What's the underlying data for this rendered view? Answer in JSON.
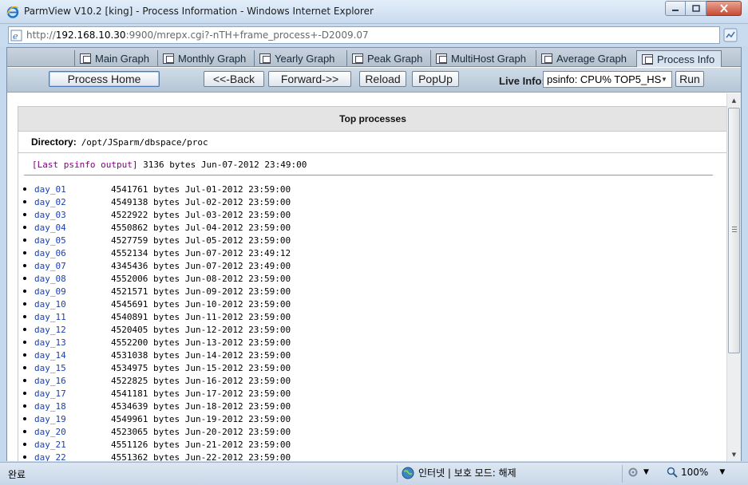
{
  "window": {
    "title": "ParmView V10.2 [king] - Process Information - Windows Internet Explorer"
  },
  "address": {
    "url_prefix": "http://",
    "url_host": "192.168.10.30",
    "url_rest": ":9900/mrepx.cgi?-nTH+frame_process+-D2009.07"
  },
  "tabs": [
    {
      "label": "Main Graph"
    },
    {
      "label": "Monthly Graph"
    },
    {
      "label": "Yearly Graph"
    },
    {
      "label": "Peak Graph"
    },
    {
      "label": "MultiHost Graph"
    },
    {
      "label": "Average Graph"
    },
    {
      "label": "Process Info"
    }
  ],
  "toolbar": {
    "process_home": "Process Home",
    "back": "<<-Back",
    "forward": "Forward->>",
    "reload": "Reload",
    "popup": "PopUp",
    "live_info_label": "Live Info:",
    "live_info_value": "psinfo: CPU% TOP5_HS",
    "run": "Run"
  },
  "panel": {
    "title": "Top processes",
    "directory_label": "Directory:",
    "directory_value": "/opt/JSparm/dbspace/proc",
    "last_link": "[Last psinfo output]",
    "last_info": "3136 bytes Jun-07-2012 23:49:00"
  },
  "files": [
    {
      "name": "day_01",
      "info": "4541761 bytes Jul-01-2012 23:59:00"
    },
    {
      "name": "day_02",
      "info": "4549138 bytes Jul-02-2012 23:59:00"
    },
    {
      "name": "day_03",
      "info": "4522922 bytes Jul-03-2012 23:59:00"
    },
    {
      "name": "day_04",
      "info": "4550862 bytes Jul-04-2012 23:59:00"
    },
    {
      "name": "day_05",
      "info": "4527759 bytes Jul-05-2012 23:59:00"
    },
    {
      "name": "day_06",
      "info": "4552134 bytes Jun-07-2012 23:49:12"
    },
    {
      "name": "day_07",
      "info": "4345436 bytes Jun-07-2012 23:49:00"
    },
    {
      "name": "day_08",
      "info": "4552006 bytes Jun-08-2012 23:59:00"
    },
    {
      "name": "day_09",
      "info": "4521571 bytes Jun-09-2012 23:59:00"
    },
    {
      "name": "day_10",
      "info": "4545691 bytes Jun-10-2012 23:59:00"
    },
    {
      "name": "day_11",
      "info": "4540891 bytes Jun-11-2012 23:59:00"
    },
    {
      "name": "day_12",
      "info": "4520405 bytes Jun-12-2012 23:59:00"
    },
    {
      "name": "day_13",
      "info": "4552200 bytes Jun-13-2012 23:59:00"
    },
    {
      "name": "day_14",
      "info": "4531038 bytes Jun-14-2012 23:59:00"
    },
    {
      "name": "day_15",
      "info": "4534975 bytes Jun-15-2012 23:59:00"
    },
    {
      "name": "day_16",
      "info": "4522825 bytes Jun-16-2012 23:59:00"
    },
    {
      "name": "day_17",
      "info": "4541181 bytes Jun-17-2012 23:59:00"
    },
    {
      "name": "day_18",
      "info": "4534639 bytes Jun-18-2012 23:59:00"
    },
    {
      "name": "day_19",
      "info": "4549961 bytes Jun-19-2012 23:59:00"
    },
    {
      "name": "day_20",
      "info": "4523065 bytes Jun-20-2012 23:59:00"
    },
    {
      "name": "day_21",
      "info": "4551126 bytes Jun-21-2012 23:59:00"
    },
    {
      "name": "day_22",
      "info": "4551362 bytes Jun-22-2012 23:59:00"
    }
  ],
  "status": {
    "done_text": "완료",
    "zone_text": "인터넷 | 보호 모드: 해제",
    "zoom_text": "100%"
  },
  "icons": {
    "browser": "ie-icon",
    "page": "page-icon",
    "globe": "globe-icon",
    "zoom": "magnifier-icon"
  }
}
